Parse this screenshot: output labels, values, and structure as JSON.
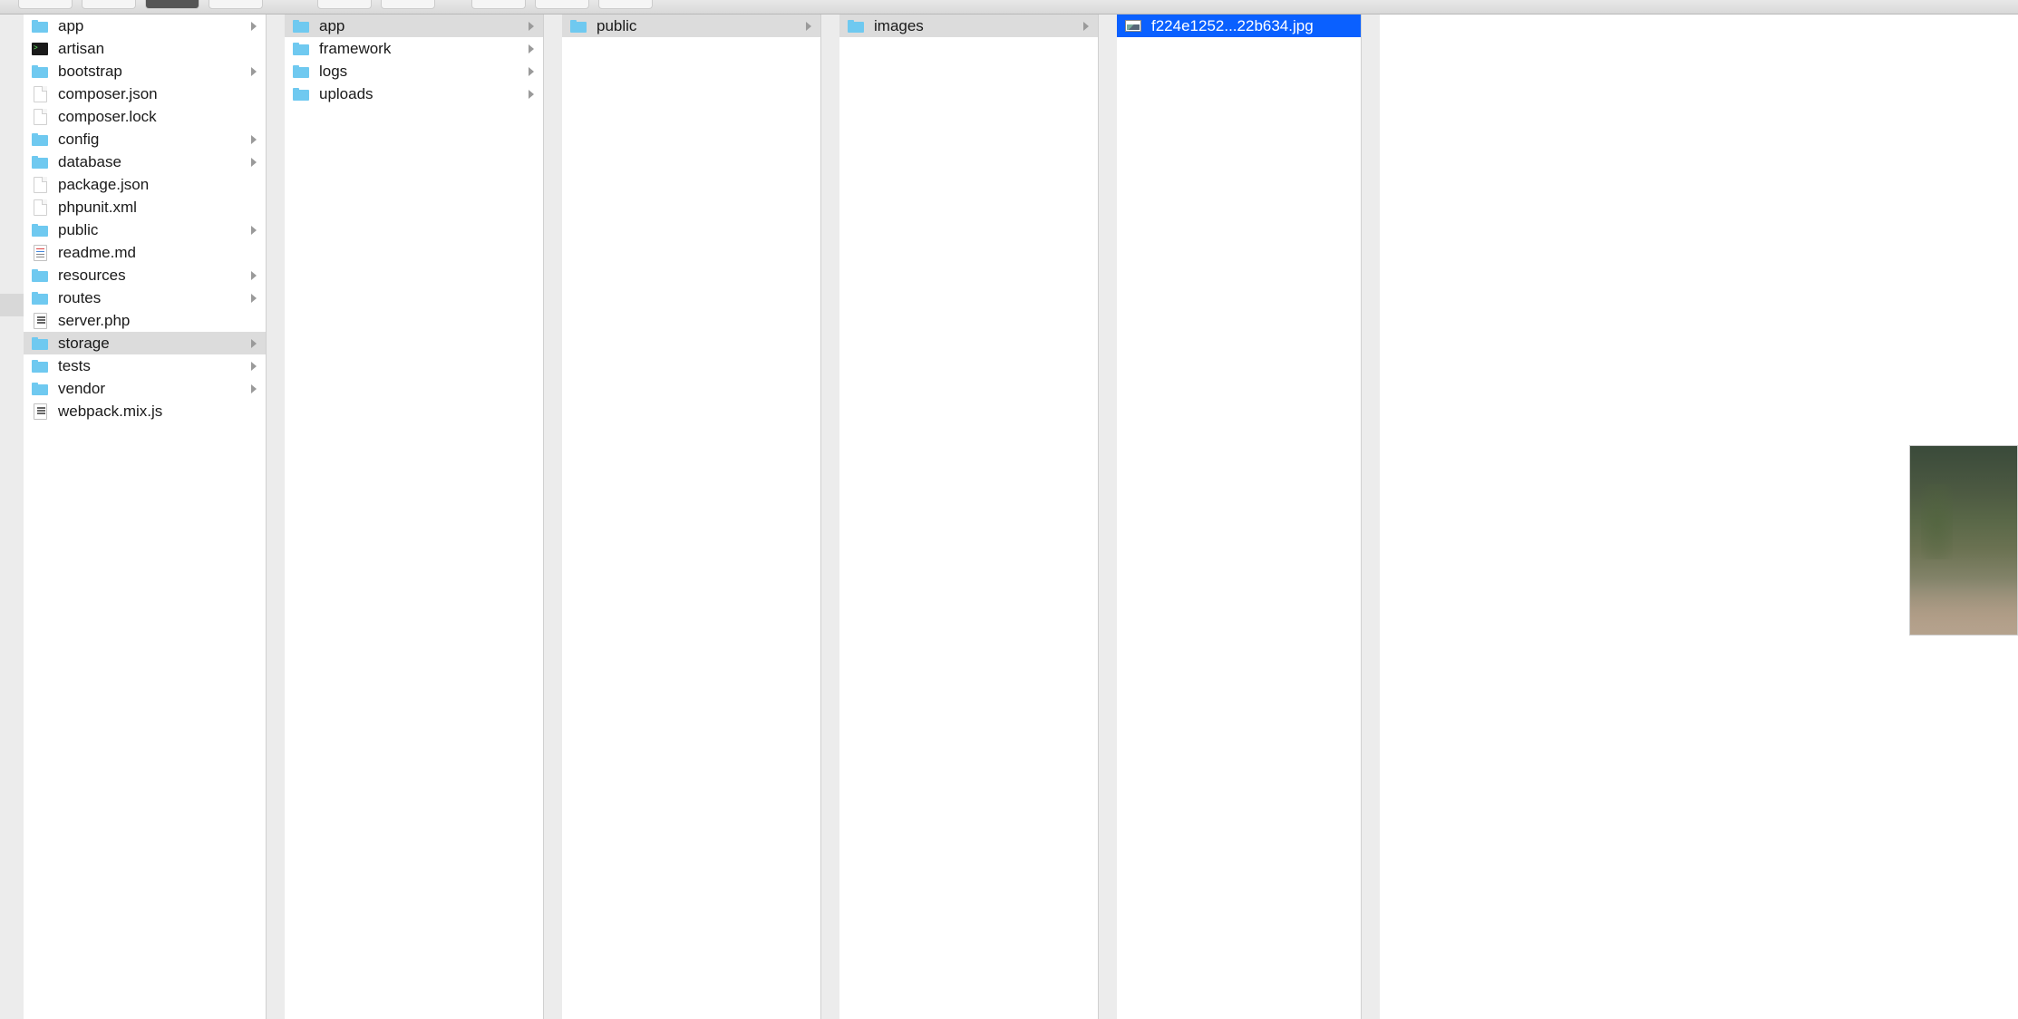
{
  "columns": [
    {
      "items": [
        {
          "name": "app",
          "type": "folder",
          "hasChildren": true,
          "selected": false
        },
        {
          "name": "artisan",
          "type": "terminal",
          "hasChildren": false,
          "selected": false
        },
        {
          "name": "bootstrap",
          "type": "folder",
          "hasChildren": true,
          "selected": false
        },
        {
          "name": "composer.json",
          "type": "file-blank",
          "hasChildren": false,
          "selected": false
        },
        {
          "name": "composer.lock",
          "type": "file-blank",
          "hasChildren": false,
          "selected": false
        },
        {
          "name": "config",
          "type": "folder",
          "hasChildren": true,
          "selected": false
        },
        {
          "name": "database",
          "type": "folder",
          "hasChildren": true,
          "selected": false
        },
        {
          "name": "package.json",
          "type": "file-blank",
          "hasChildren": false,
          "selected": false
        },
        {
          "name": "phpunit.xml",
          "type": "file-blank",
          "hasChildren": false,
          "selected": false
        },
        {
          "name": "public",
          "type": "folder",
          "hasChildren": true,
          "selected": false
        },
        {
          "name": "readme.md",
          "type": "doc",
          "hasChildren": false,
          "selected": false
        },
        {
          "name": "resources",
          "type": "folder",
          "hasChildren": true,
          "selected": false
        },
        {
          "name": "routes",
          "type": "folder",
          "hasChildren": true,
          "selected": false
        },
        {
          "name": "server.php",
          "type": "code",
          "hasChildren": false,
          "selected": false
        },
        {
          "name": "storage",
          "type": "folder",
          "hasChildren": true,
          "selected": "path"
        },
        {
          "name": "tests",
          "type": "folder",
          "hasChildren": true,
          "selected": false
        },
        {
          "name": "vendor",
          "type": "folder",
          "hasChildren": true,
          "selected": false
        },
        {
          "name": "webpack.mix.js",
          "type": "code",
          "hasChildren": false,
          "selected": false
        }
      ]
    },
    {
      "items": [
        {
          "name": "app",
          "type": "folder",
          "hasChildren": true,
          "selected": "path"
        },
        {
          "name": "framework",
          "type": "folder",
          "hasChildren": true,
          "selected": false
        },
        {
          "name": "logs",
          "type": "folder",
          "hasChildren": true,
          "selected": false
        },
        {
          "name": "uploads",
          "type": "folder",
          "hasChildren": true,
          "selected": false
        }
      ]
    },
    {
      "items": [
        {
          "name": "public",
          "type": "folder",
          "hasChildren": true,
          "selected": "path"
        }
      ]
    },
    {
      "items": [
        {
          "name": "images",
          "type": "folder",
          "hasChildren": true,
          "selected": "path"
        }
      ]
    },
    {
      "items": [
        {
          "name": "f224e1252...22b634.jpg",
          "type": "image",
          "hasChildren": false,
          "selected": "active"
        }
      ]
    }
  ],
  "preview": {
    "filename": "f224e1252...22b634.jpg"
  }
}
